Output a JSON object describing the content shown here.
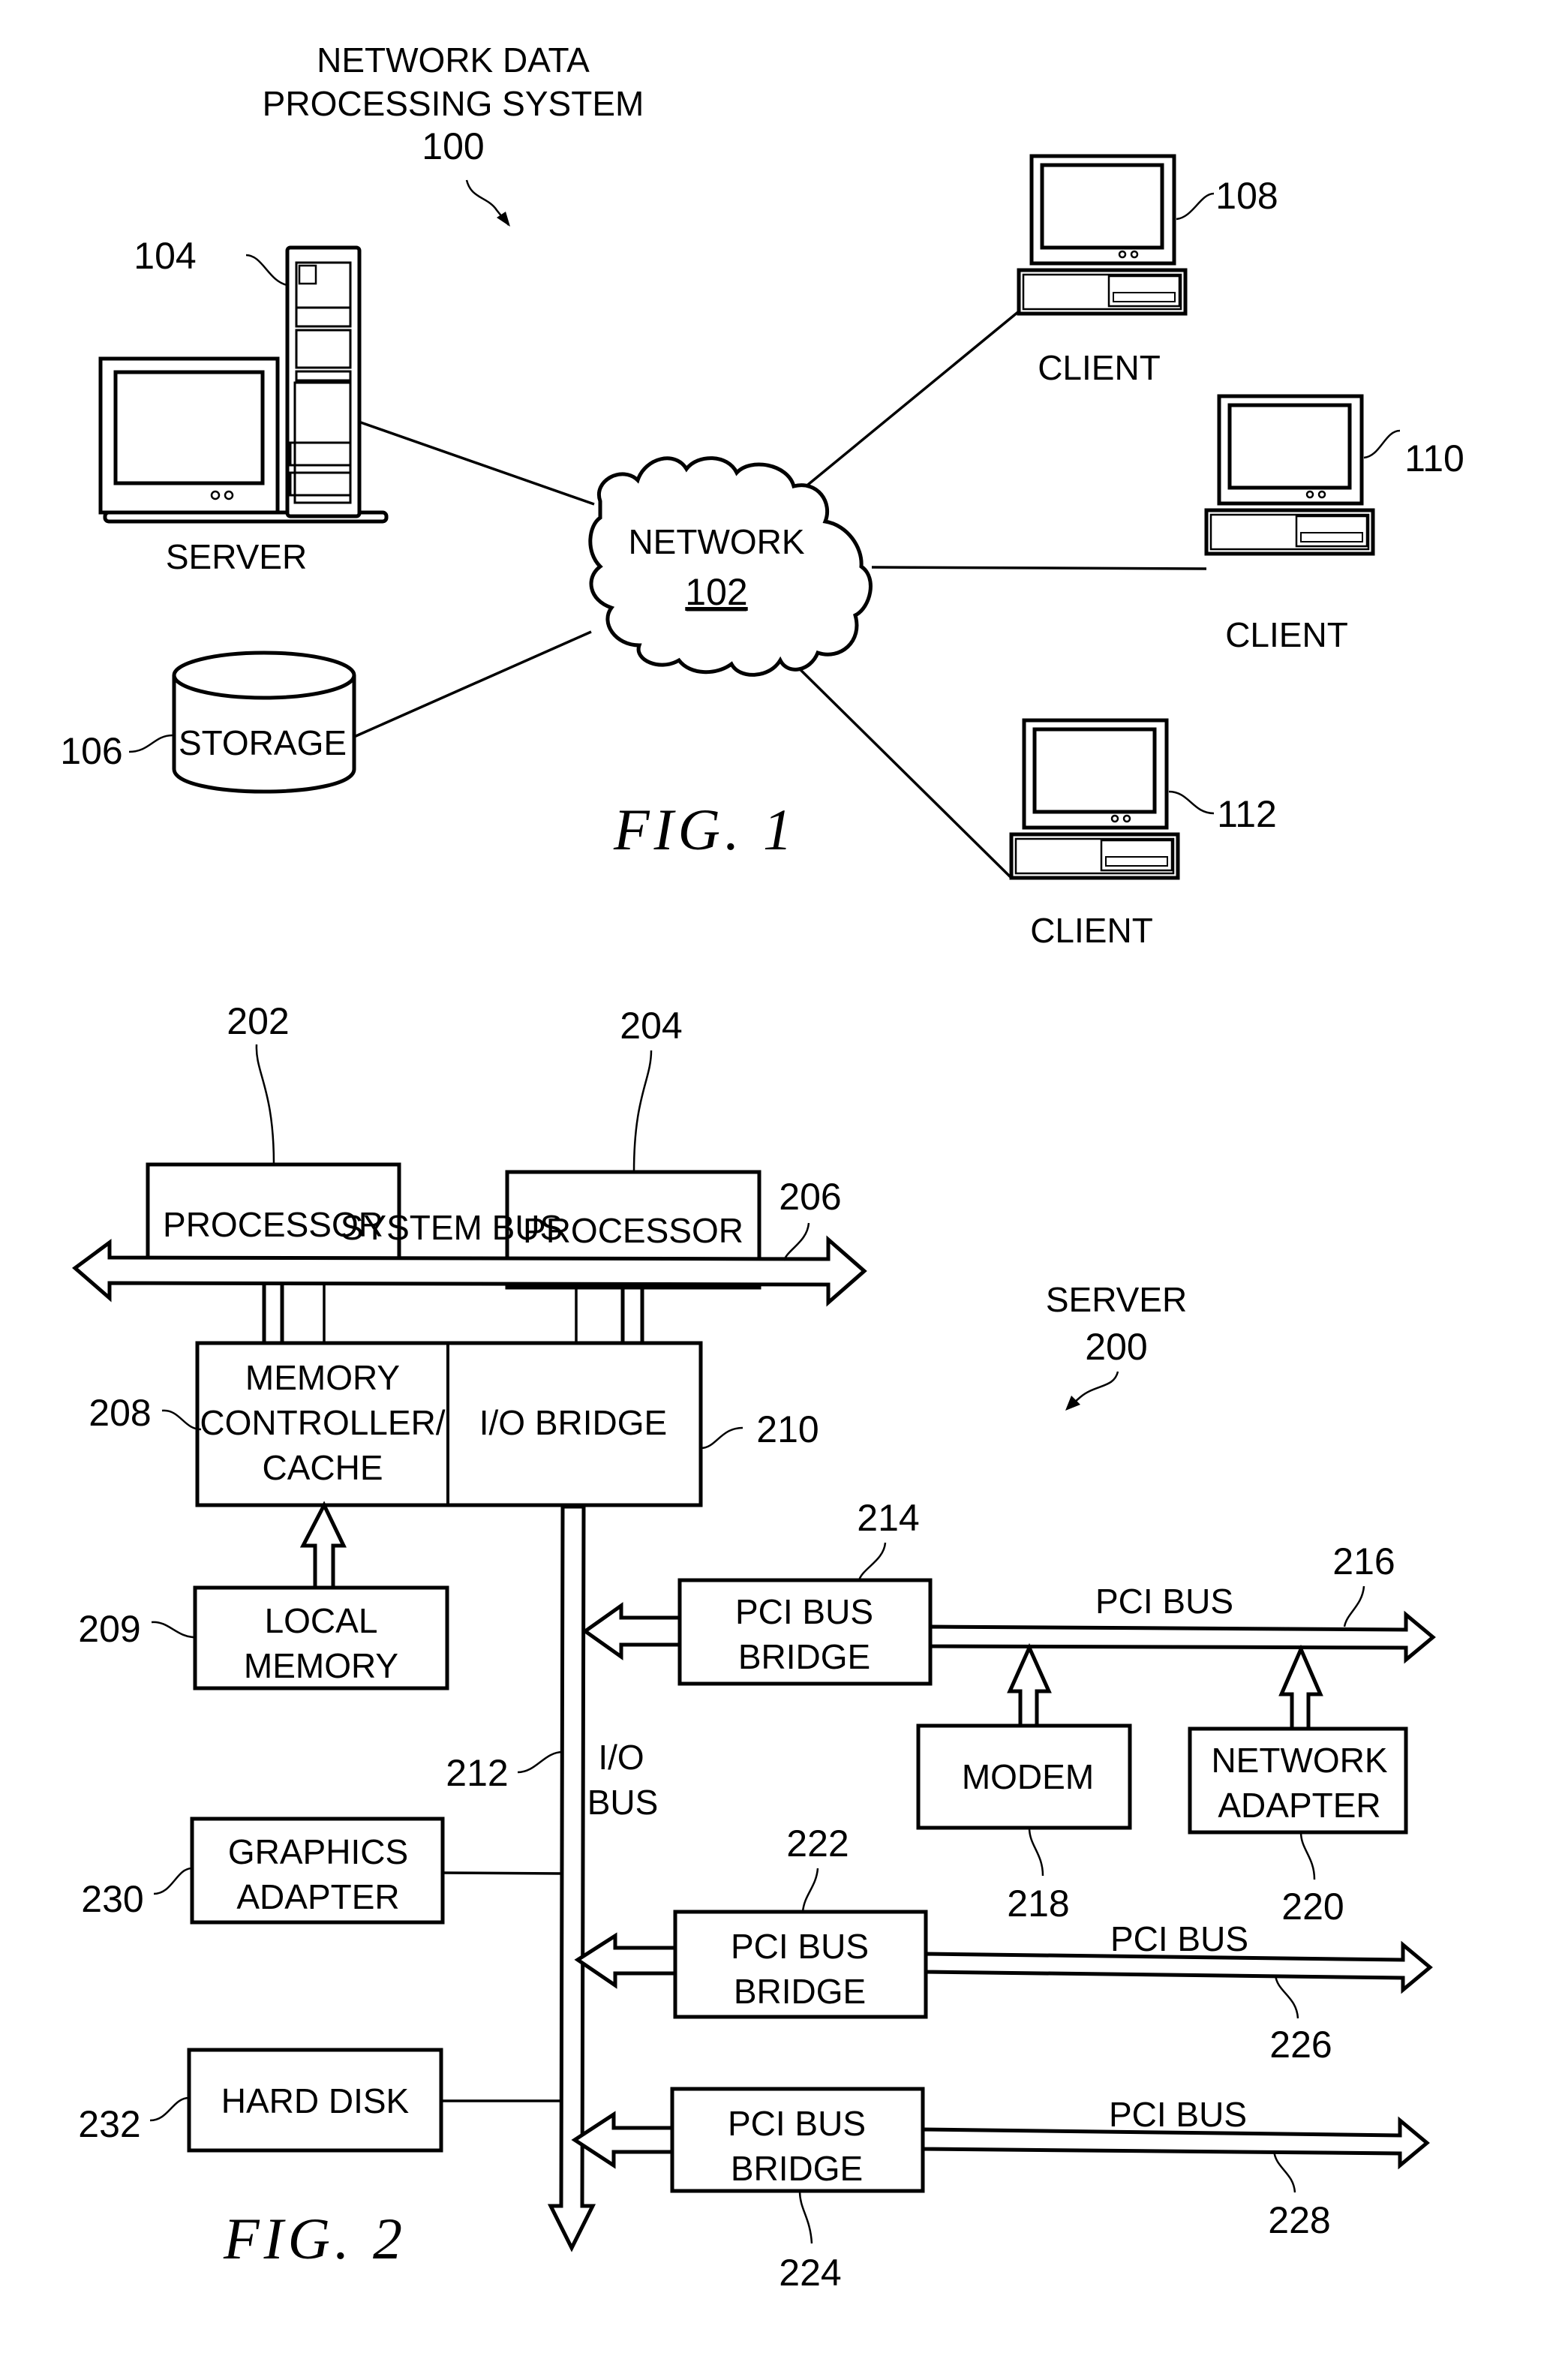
{
  "fig1": {
    "caption": "FIG. 1",
    "title_line1": "NETWORK DATA",
    "title_line2": "PROCESSING SYSTEM",
    "title_ref": "100",
    "server": {
      "label": "SERVER",
      "ref": "104"
    },
    "network": {
      "label": "NETWORK",
      "ref": "102"
    },
    "storage": {
      "label": "STORAGE",
      "ref": "106"
    },
    "clients": [
      {
        "label": "CLIENT",
        "ref": "108"
      },
      {
        "label": "CLIENT",
        "ref": "110"
      },
      {
        "label": "CLIENT",
        "ref": "112"
      }
    ]
  },
  "fig2": {
    "caption": "FIG. 2",
    "title_line1": "SERVER",
    "title_ref": "200",
    "processors": [
      {
        "label": "PROCESSOR",
        "ref": "202"
      },
      {
        "label": "PROCESSOR",
        "ref": "204"
      }
    ],
    "system_bus": {
      "label": "SYSTEM BUS",
      "ref": "206"
    },
    "memory_controller": {
      "line1": "MEMORY",
      "line2": "CONTROLLER/",
      "line3": "CACHE",
      "ref": "208"
    },
    "local_memory": {
      "line1": "LOCAL",
      "line2": "MEMORY",
      "ref": "209"
    },
    "io_bridge": {
      "label": "I/O BRIDGE",
      "ref": "210"
    },
    "io_bus": {
      "line1": "I/O",
      "line2": "BUS",
      "ref": "212"
    },
    "pci_bridges": [
      {
        "line1": "PCI BUS",
        "line2": "BRIDGE",
        "ref": "214",
        "bus_label": "PCI BUS",
        "bus_ref": "216"
      },
      {
        "line1": "PCI BUS",
        "line2": "BRIDGE",
        "ref": "222",
        "bus_label": "PCI BUS",
        "bus_ref": "226"
      },
      {
        "line1": "PCI BUS",
        "line2": "BRIDGE",
        "ref": "224",
        "bus_label": "PCI BUS",
        "bus_ref": "228"
      }
    ],
    "modem": {
      "label": "MODEM",
      "ref": "218"
    },
    "network_adapter": {
      "line1": "NETWORK",
      "line2": "ADAPTER",
      "ref": "220"
    },
    "graphics_adapter": {
      "line1": "GRAPHICS",
      "line2": "ADAPTER",
      "ref": "230"
    },
    "hard_disk": {
      "label": "HARD DISK",
      "ref": "232"
    }
  }
}
